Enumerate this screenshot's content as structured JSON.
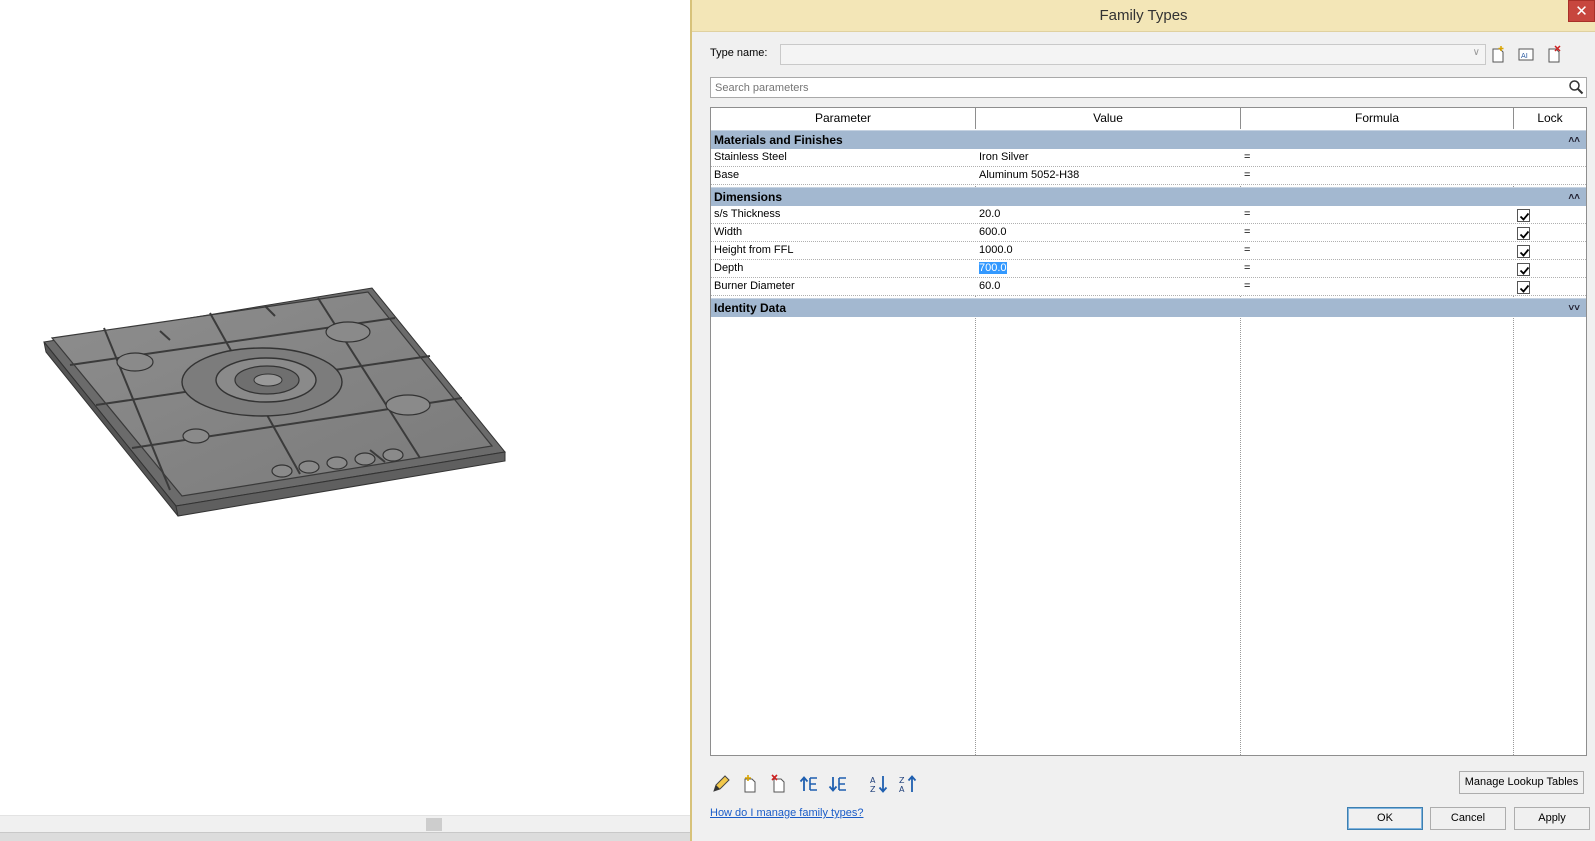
{
  "dialog": {
    "title": "Family Types",
    "close_glyph": "✕",
    "type_name_label": "Type name:",
    "type_name_value": "",
    "search_placeholder": "Search parameters",
    "toolbar_icons": [
      "new-type-icon",
      "rename-type-icon",
      "delete-type-icon"
    ],
    "columns": [
      "Parameter",
      "Value",
      "Formula",
      "Lock"
    ],
    "groups": [
      {
        "name": "Materials and Finishes",
        "expanded": true,
        "rows": [
          {
            "parameter": "Stainless Steel",
            "value": "Iron Silver",
            "formula": "=",
            "locked": null
          },
          {
            "parameter": "Base",
            "value": "Aluminum 5052-H38",
            "formula": "=",
            "locked": null
          }
        ]
      },
      {
        "name": "Dimensions",
        "expanded": true,
        "rows": [
          {
            "parameter": "s/s Thickness",
            "value": "20.0",
            "formula": "=",
            "locked": true
          },
          {
            "parameter": "Width",
            "value": "600.0",
            "formula": "=",
            "locked": true
          },
          {
            "parameter": "Height from FFL",
            "value": "1000.0",
            "formula": "=",
            "locked": true
          },
          {
            "parameter": "Depth",
            "value": "700.0",
            "formula": "=",
            "locked": true,
            "selected": true
          },
          {
            "parameter": "Burner Diameter",
            "value": "60.0",
            "formula": "=",
            "locked": true
          }
        ]
      },
      {
        "name": "Identity Data",
        "expanded": false,
        "rows": []
      }
    ],
    "bottom_icons": [
      "edit-parameter-icon",
      "new-parameter-icon",
      "delete-parameter-icon",
      "move-up-icon",
      "move-down-icon",
      "sort-ascending-icon",
      "sort-descending-icon"
    ],
    "manage_lookup_label": "Manage Lookup Tables",
    "help_link": "How do I manage family types?",
    "ok_label": "OK",
    "cancel_label": "Cancel",
    "apply_label": "Apply"
  },
  "colors": {
    "title_bar": "#f3e6b7",
    "group_header": "#a3b8d0",
    "selection": "#3399ff",
    "close_button": "#c7463e",
    "link": "#1a5cc8"
  }
}
